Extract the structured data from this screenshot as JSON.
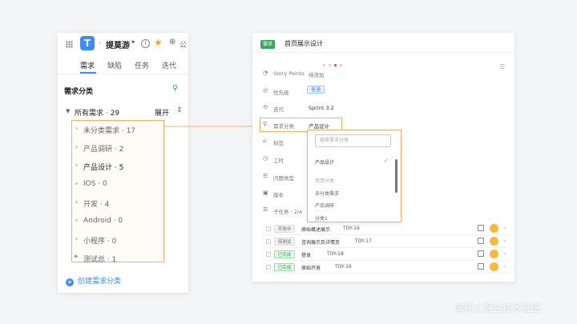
{
  "left_panel": {
    "project_name": "提莫游",
    "globe_text": "公",
    "tabs": [
      "需求",
      "缺陷",
      "任务",
      "迭代"
    ],
    "section_title": "需求分类",
    "all_label": "所有需求 · 29",
    "expand_label": "展开",
    "categories": [
      "未分类需求 · 17",
      "产品调研 · 2",
      "产品设计 · 5",
      "IOS · 0",
      "开发 · 4",
      "Android · 0",
      "小程序 · 0",
      "测试总 · 1"
    ],
    "create_label": "创建需求分类"
  },
  "right_panel": {
    "badge": "需求",
    "title": "首页展示设计",
    "fields": [
      {
        "icon": "points-icon",
        "glyph": "◔",
        "label": "Story Points",
        "value": "待添加",
        "muted": true
      },
      {
        "icon": "priority-icon",
        "glyph": "◎",
        "label": "优先级",
        "value": "",
        "muted": false
      },
      {
        "icon": "iteration-icon",
        "glyph": "⟲",
        "label": "迭代",
        "value": "Sprint 3.2",
        "muted": false
      },
      {
        "icon": "category-icon",
        "glyph": "⚲",
        "label": "需求分类",
        "value": "产品设计",
        "muted": false
      },
      {
        "icon": "tag-icon",
        "glyph": "⌂",
        "label": "标签",
        "value": "",
        "muted": false
      },
      {
        "icon": "time-icon",
        "glyph": "◷",
        "label": "工时",
        "value": "",
        "muted": false
      },
      {
        "icon": "issue-type-icon",
        "glyph": "☰",
        "label": "问题类型",
        "value": "",
        "muted": false
      },
      {
        "icon": "version-icon",
        "glyph": "▣",
        "label": "版本",
        "value": "",
        "muted": false
      },
      {
        "icon": "subtask-icon",
        "glyph": "☰",
        "label": "子任务 · 2/4",
        "value": "",
        "muted": false
      }
    ],
    "priority_pill": "普通",
    "dropdown": {
      "placeholder": "搜索需求分类",
      "selected": "产品设计",
      "group_label": "常用分类",
      "items": [
        "未分类需求",
        "产品调研",
        "分类1"
      ]
    },
    "subtasks": [
      {
        "status": "开发中",
        "status_color": "gray",
        "title": "原始概述展示",
        "id": "TOY-16"
      },
      {
        "status": "待测试",
        "status_color": "gray",
        "title": "咨询展示及详情页",
        "id": "TOY-17"
      },
      {
        "status": "已完成",
        "status_color": "green",
        "title": "登录",
        "id": "TOY-18"
      },
      {
        "status": "已完成",
        "status_color": "green",
        "title": "原始开发",
        "id": "TOY-16"
      }
    ]
  },
  "watermark": "@稀土掘金技术社区"
}
